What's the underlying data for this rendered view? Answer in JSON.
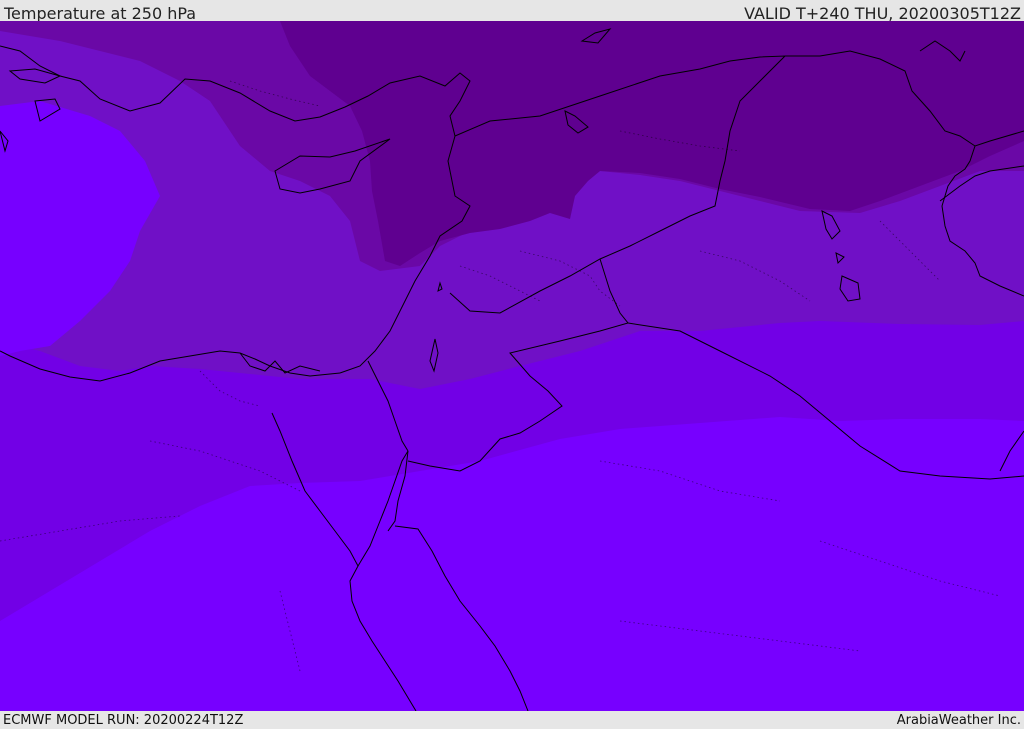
{
  "header": {
    "title": "Temperature at 250 hPa",
    "valid": "VALID T+240 THU, 20200305T12Z"
  },
  "footer": {
    "model_run": "ECMWF MODEL RUN: 20200224T12Z",
    "credit": "ArabiaWeather Inc."
  },
  "colors": {
    "band_warmest": "#7700ff",
    "band_2": "#7200e6",
    "band_3": "#7010c6",
    "band_4": "#6a08a6",
    "band_coldest": "#5f0090",
    "coast_line": "#000000",
    "frame_gray": "#e6e6e6"
  }
}
